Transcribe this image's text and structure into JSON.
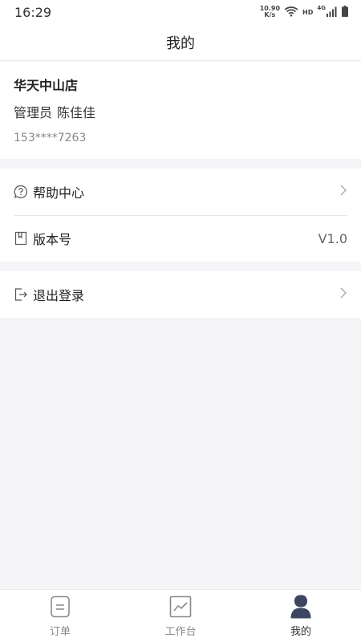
{
  "status_bar": {
    "time": "16:29",
    "net_speed_value": "10.90",
    "net_speed_unit": "K/s",
    "hd": "HD",
    "network": "4G",
    "icons": [
      "wifi-icon",
      "signal-icon",
      "battery-icon"
    ]
  },
  "header": {
    "title": "我的"
  },
  "profile": {
    "store_name": "华天中山店",
    "role": "管理员",
    "user_name": "陈佳佳",
    "phone": "153****7263"
  },
  "menu": {
    "help": {
      "label": "帮助中心",
      "icon": "help-bubble-icon"
    },
    "version": {
      "label": "版本号",
      "value": "V1.0",
      "icon": "book-icon"
    },
    "logout": {
      "label": "退出登录",
      "icon": "logout-icon"
    }
  },
  "tabs": {
    "orders": {
      "label": "订单",
      "icon": "document-icon"
    },
    "workbench": {
      "label": "工作台",
      "icon": "chart-icon"
    },
    "mine": {
      "label": "我的",
      "icon": "user-icon",
      "active": true
    }
  },
  "colors": {
    "background": "#f5f5f7",
    "surface": "#ffffff",
    "text_primary": "#222222",
    "text_secondary": "#888888",
    "active_icon": "#3d4660",
    "inactive_icon": "#8a8a8a"
  }
}
